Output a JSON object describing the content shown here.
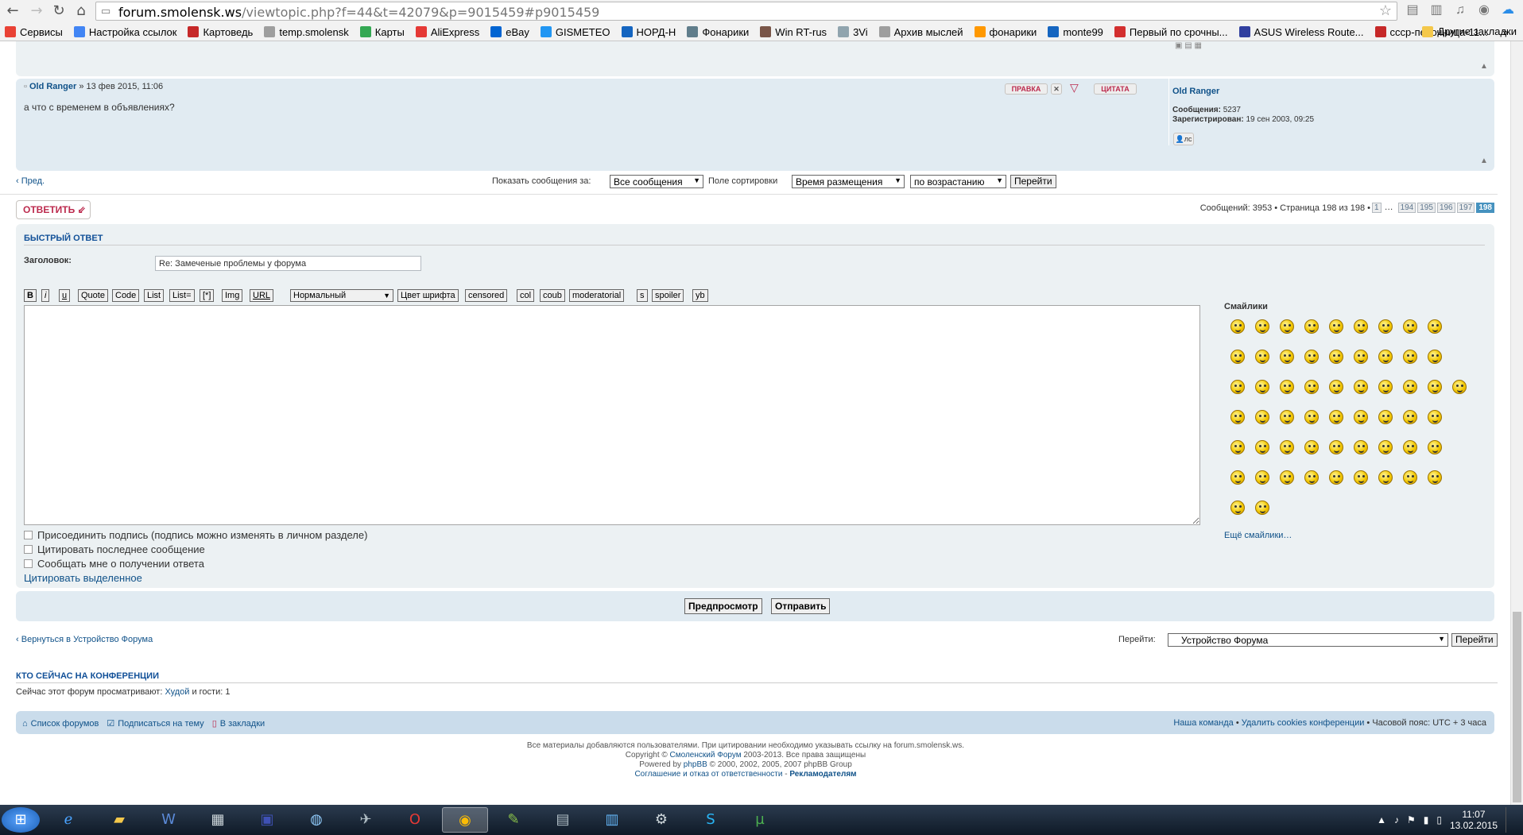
{
  "browser": {
    "url_host": "forum.smolensk.ws",
    "url_path": "/viewtopic.php?f=44&t=42079&p=9015459#p9015459",
    "bookmarks": [
      {
        "label": "Сервисы",
        "color": "#e94235"
      },
      {
        "label": "Настройка ссылок",
        "color": "#4285f4"
      },
      {
        "label": "Картоведь",
        "color": "#c62828"
      },
      {
        "label": "temp.smolensk",
        "color": "#9e9e9e"
      },
      {
        "label": "Карты",
        "color": "#34a853"
      },
      {
        "label": "AliExpress",
        "color": "#e53935"
      },
      {
        "label": "eBay",
        "color": "#0064d2"
      },
      {
        "label": "GISMETEO",
        "color": "#2196f3"
      },
      {
        "label": "НОРД-Н",
        "color": "#1565c0"
      },
      {
        "label": "Фонарики",
        "color": "#607d8b"
      },
      {
        "label": "Win RT-rus",
        "color": "#795548"
      },
      {
        "label": "3Vi",
        "color": "#90a4ae"
      },
      {
        "label": "Архив мыслей",
        "color": "#9e9e9e"
      },
      {
        "label": "фонарики",
        "color": "#ff9800"
      },
      {
        "label": "monte99",
        "color": "#1565c0"
      },
      {
        "label": "Первый по срочны...",
        "color": "#d32f2f"
      },
      {
        "label": "ASUS Wireless Route...",
        "color": "#303f9f"
      },
      {
        "label": "сссp-песочница-11...",
        "color": "#c62828"
      }
    ],
    "bookmarks_overflow": "»",
    "other_bookmarks": "Другие закладки"
  },
  "post": {
    "author": "Old Ranger",
    "date": "» 13 фев 2015, 11:06",
    "text": "а что с временем в объявлениях?",
    "edit_label": "ПРАВКА",
    "quote_label": "ЦИТАТА",
    "profile": {
      "name": "Old Ranger",
      "posts_label": "Сообщения:",
      "posts": "5237",
      "registered_label": "Зарегистрирован:",
      "registered": "19 сен 2003, 09:25",
      "pm_label": "лс"
    }
  },
  "sort": {
    "prev": "Пред.",
    "show_label": "Показать сообщения за:",
    "show_value": "Все сообщения",
    "sort_label": "Поле сортировки",
    "sort_value": "Время размещения",
    "dir_value": "по возрастанию",
    "go": "Перейти"
  },
  "pagination": {
    "reply": "ОТВЕТИТЬ",
    "summary": "Сообщений: 3953 • Страница 198 из 198 •",
    "pages": [
      "1",
      "…",
      "194",
      "195",
      "196",
      "197",
      "198"
    ],
    "current": "198"
  },
  "quick_reply": {
    "title": "БЫСТРЫЙ ОТВЕТ",
    "subject_label": "Заголовок:",
    "subject_value": "Re: Замеченые проблемы у форума",
    "toolbar": [
      "B",
      "i",
      "u",
      "Quote",
      "Code",
      "List",
      "List=",
      "[*]",
      "Img",
      "URL"
    ],
    "size_value": "Нормальный",
    "toolbar2": [
      "Цвет шрифта",
      "censored",
      "col",
      "coub",
      "moderatorial",
      "s",
      "spoiler",
      "yb"
    ],
    "smilies_title": "Смайлики",
    "more_smilies": "Ещё смайлики…",
    "options": [
      "Присоединить подпись (подпись можно изменять в личном разделе)",
      "Цитировать последнее сообщение",
      "Сообщать мне о получении ответа"
    ],
    "quote_selected": "Цитировать выделенное",
    "preview": "Предпросмотр",
    "submit": "Отправить"
  },
  "jump": {
    "back": "Вернуться в Устройство Форума",
    "label": "Перейти:",
    "value": "Устройство Форума",
    "go": "Перейти"
  },
  "online": {
    "title": "КТО СЕЙЧАС НА КОНФЕРЕНЦИИ",
    "text_prefix": "Сейчас этот форум просматривают:",
    "user": "Худой",
    "text_suffix": "и гости: 1"
  },
  "footer": {
    "forum_list": "Список форумов",
    "subscribe": "Подписаться на тему",
    "bookmark": "В закладки",
    "team": "Наша команда",
    "cookies": "Удалить cookies конференции",
    "tz": "Часовой пояс: UTC + 3 часа",
    "sep": "•",
    "line1": "Все материалы добавляются пользователями. При цитировании необходимо указывать ссылку на forum.smolensk.ws.",
    "line2_prefix": "Copyright ©",
    "line2_link": "Смоленский Форум",
    "line2_suffix": "2003-2013. Все права защищены",
    "line3_prefix": "Powered by",
    "line3_link": "phpBB",
    "line3_suffix": "© 2000, 2002, 2005, 2007 phpBB Group",
    "line4_link1": "Соглашение и отказ от ответственности",
    "line4_sep": "-",
    "line4_link2": "Рекламодателям"
  },
  "taskbar": {
    "time": "11:07",
    "date": "13.02.2015"
  }
}
